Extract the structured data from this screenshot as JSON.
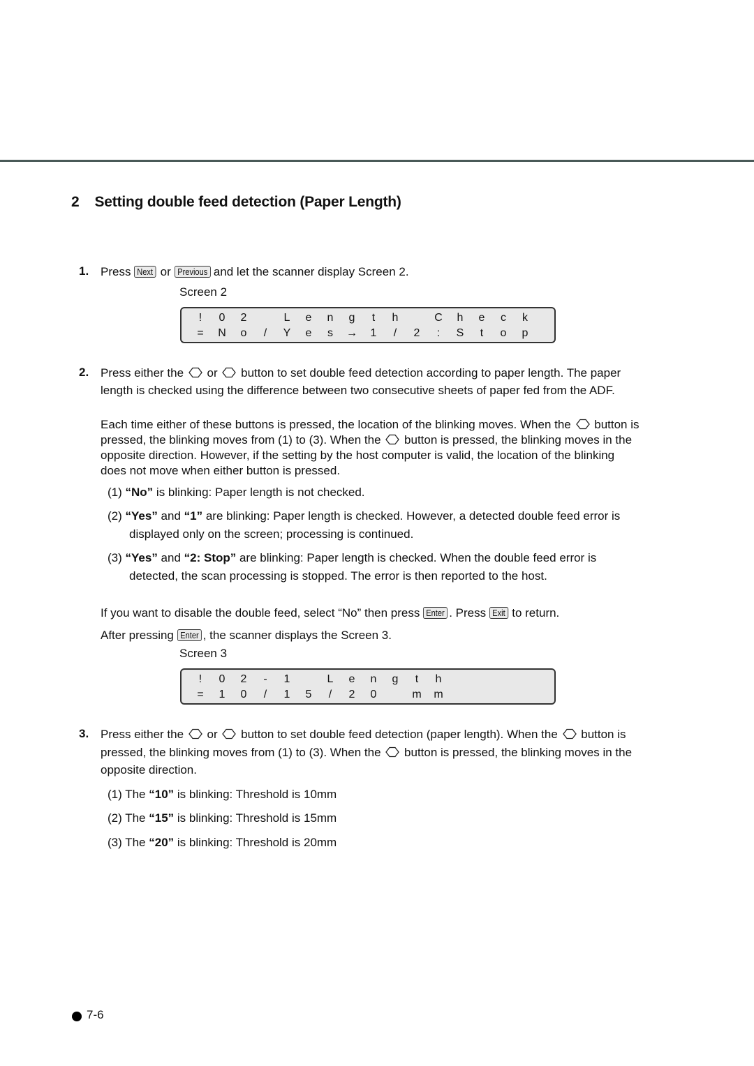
{
  "section": {
    "number": "2",
    "title": "Setting double feed detection (Paper Length)"
  },
  "keys": {
    "next": "Next",
    "previous": "Previous",
    "enter": "Enter",
    "exit": "Exit"
  },
  "step1": {
    "num": "1.",
    "press": "Press",
    "or": "or",
    "rest": "and let the scanner display Screen 2.",
    "screen_label": "Screen 2"
  },
  "screen2": {
    "row1": [
      "!",
      "0",
      "2",
      "",
      "L",
      "e",
      "n",
      "g",
      "t",
      "h",
      "",
      "C",
      "h",
      "e",
      "c",
      "k"
    ],
    "row2": [
      "=",
      "N",
      "o",
      "/",
      "Y",
      "e",
      "s",
      "→",
      "1",
      "/",
      "2",
      ":",
      "S",
      "t",
      "o",
      "p"
    ]
  },
  "step2": {
    "num": "2.",
    "l1a": "Press either the",
    "l1b": "or",
    "l1c": "button to set double feed detection according to paper length. The paper",
    "l2": "length is checked using the difference between two consecutive sheets of paper fed from the ADF.",
    "p1a": "Each time either of these buttons is pressed, the location of the blinking moves. When the",
    "p1b": "button is",
    "p2a": "pressed, the blinking moves from (1) to (3). When the",
    "p2b": "button is pressed, the blinking moves in the",
    "p3": "opposite direction. However, if the setting by the host computer is valid, the location of the blinking",
    "p4": "does not move when either button is pressed.",
    "options": [
      {
        "n": "(1)",
        "b1": "“No”",
        "t1": " is blinking: Paper length is not checked.",
        "b2": "",
        "t2": "",
        "cont": ""
      },
      {
        "n": "(2)",
        "b1": "“Yes”",
        "t1": " and ",
        "b2": "“1”",
        "t2": " are blinking: Paper length is checked. However, a detected double feed error is",
        "cont": "displayed only on the screen; processing is continued."
      },
      {
        "n": "(3)",
        "b1": "“Yes”",
        "t1": " and ",
        "b2": "“2: Stop”",
        "t2": " are blinking: Paper length is checked. When the double feed error is",
        "cont": "detected, the scan processing is stopped. The error is then reported to the host."
      }
    ],
    "disable_a": "If you want to disable the double feed, select “No” then press",
    "disable_b": ". Press",
    "disable_c": "to return.",
    "after_a": "After pressing",
    "after_b": ", the scanner displays the Screen 3.",
    "screen_label": "Screen 3"
  },
  "screen3": {
    "row1": [
      "!",
      "0",
      "2",
      "-",
      "1",
      "",
      "L",
      "e",
      "n",
      "g",
      "t",
      "h",
      "",
      "",
      "",
      ""
    ],
    "row2": [
      "=",
      "1",
      "0",
      "/",
      "1",
      "5",
      "/",
      "2",
      "0",
      "",
      "m",
      "m",
      "",
      "",
      "",
      ""
    ]
  },
  "step3": {
    "num": "3.",
    "l1a": "Press either the",
    "l1b": "or",
    "l1c": "button to set double feed detection (paper length). When the",
    "l1d": "button is",
    "l2a": "pressed, the blinking moves from (1) to (3). When the",
    "l2b": "button is pressed, the blinking moves in the",
    "l3": "opposite direction.",
    "options": [
      {
        "n": "(1)",
        "pre": "The ",
        "b": "“10”",
        "post": " is blinking: Threshold is 10mm"
      },
      {
        "n": "(2)",
        "pre": "The ",
        "b": "“15”",
        "post": " is blinking: Threshold is 15mm"
      },
      {
        "n": "(3)",
        "pre": "The ",
        "b": "“20”",
        "post": " is blinking: Threshold is 20mm"
      }
    ]
  },
  "footer": {
    "page": "7-6"
  }
}
